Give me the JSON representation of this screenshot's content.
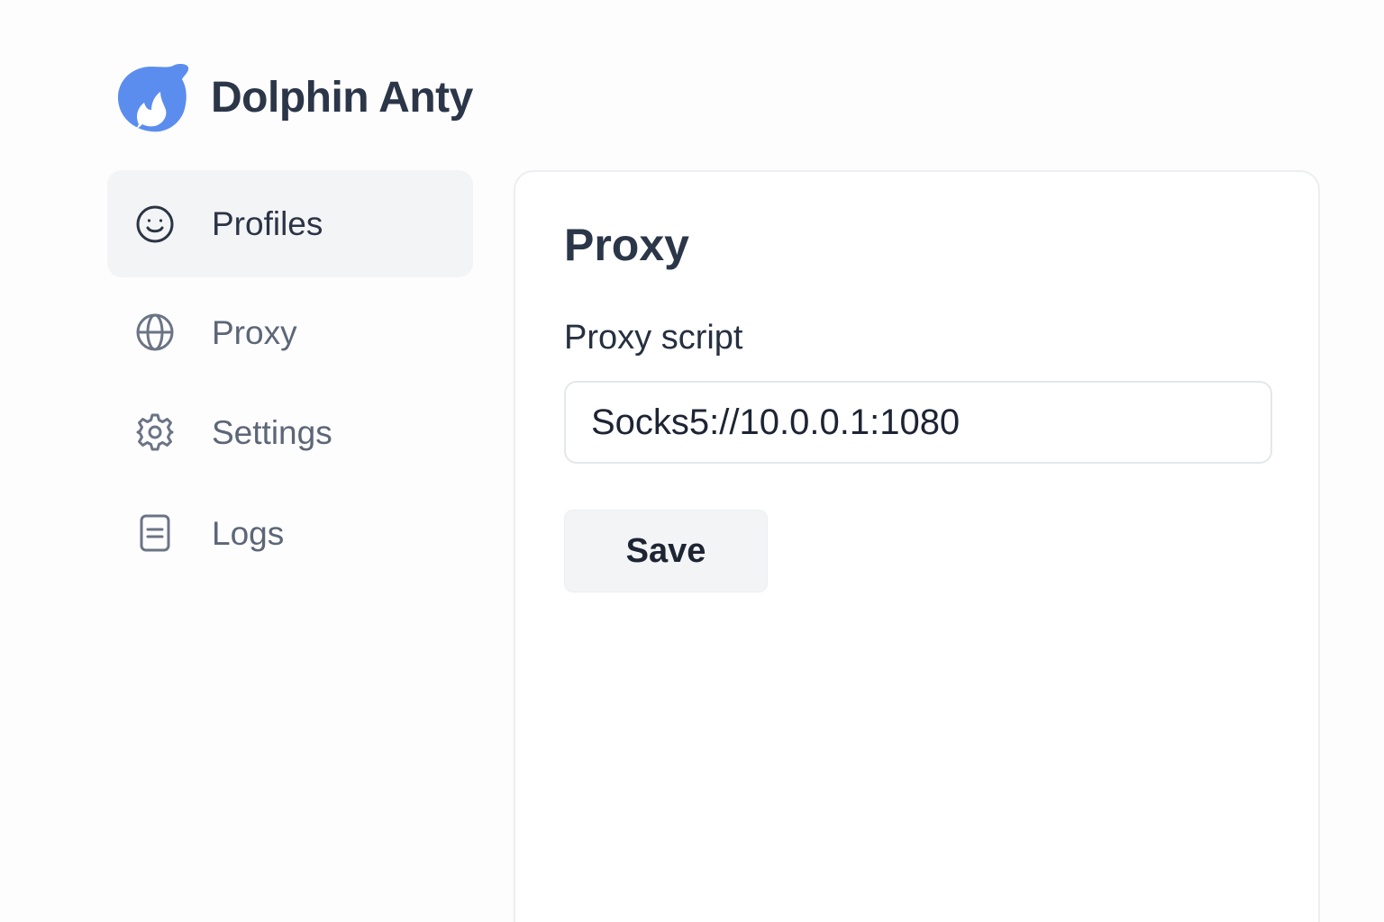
{
  "app": {
    "name": "Dolphin Anty",
    "logo_icon": "dolphin-logo-icon",
    "accent_color": "#5b8def"
  },
  "sidebar": {
    "items": [
      {
        "label": "Profiles",
        "icon": "smiley-face-icon",
        "active": true
      },
      {
        "label": "Proxy",
        "icon": "globe-icon",
        "active": false
      },
      {
        "label": "Settings",
        "icon": "gear-icon",
        "active": false
      },
      {
        "label": "Logs",
        "icon": "document-icon",
        "active": false
      }
    ]
  },
  "main": {
    "title": "Proxy",
    "field_label": "Proxy script",
    "proxy_input_value": "Socks5://10.0.0.1:1080",
    "save_label": "Save"
  }
}
